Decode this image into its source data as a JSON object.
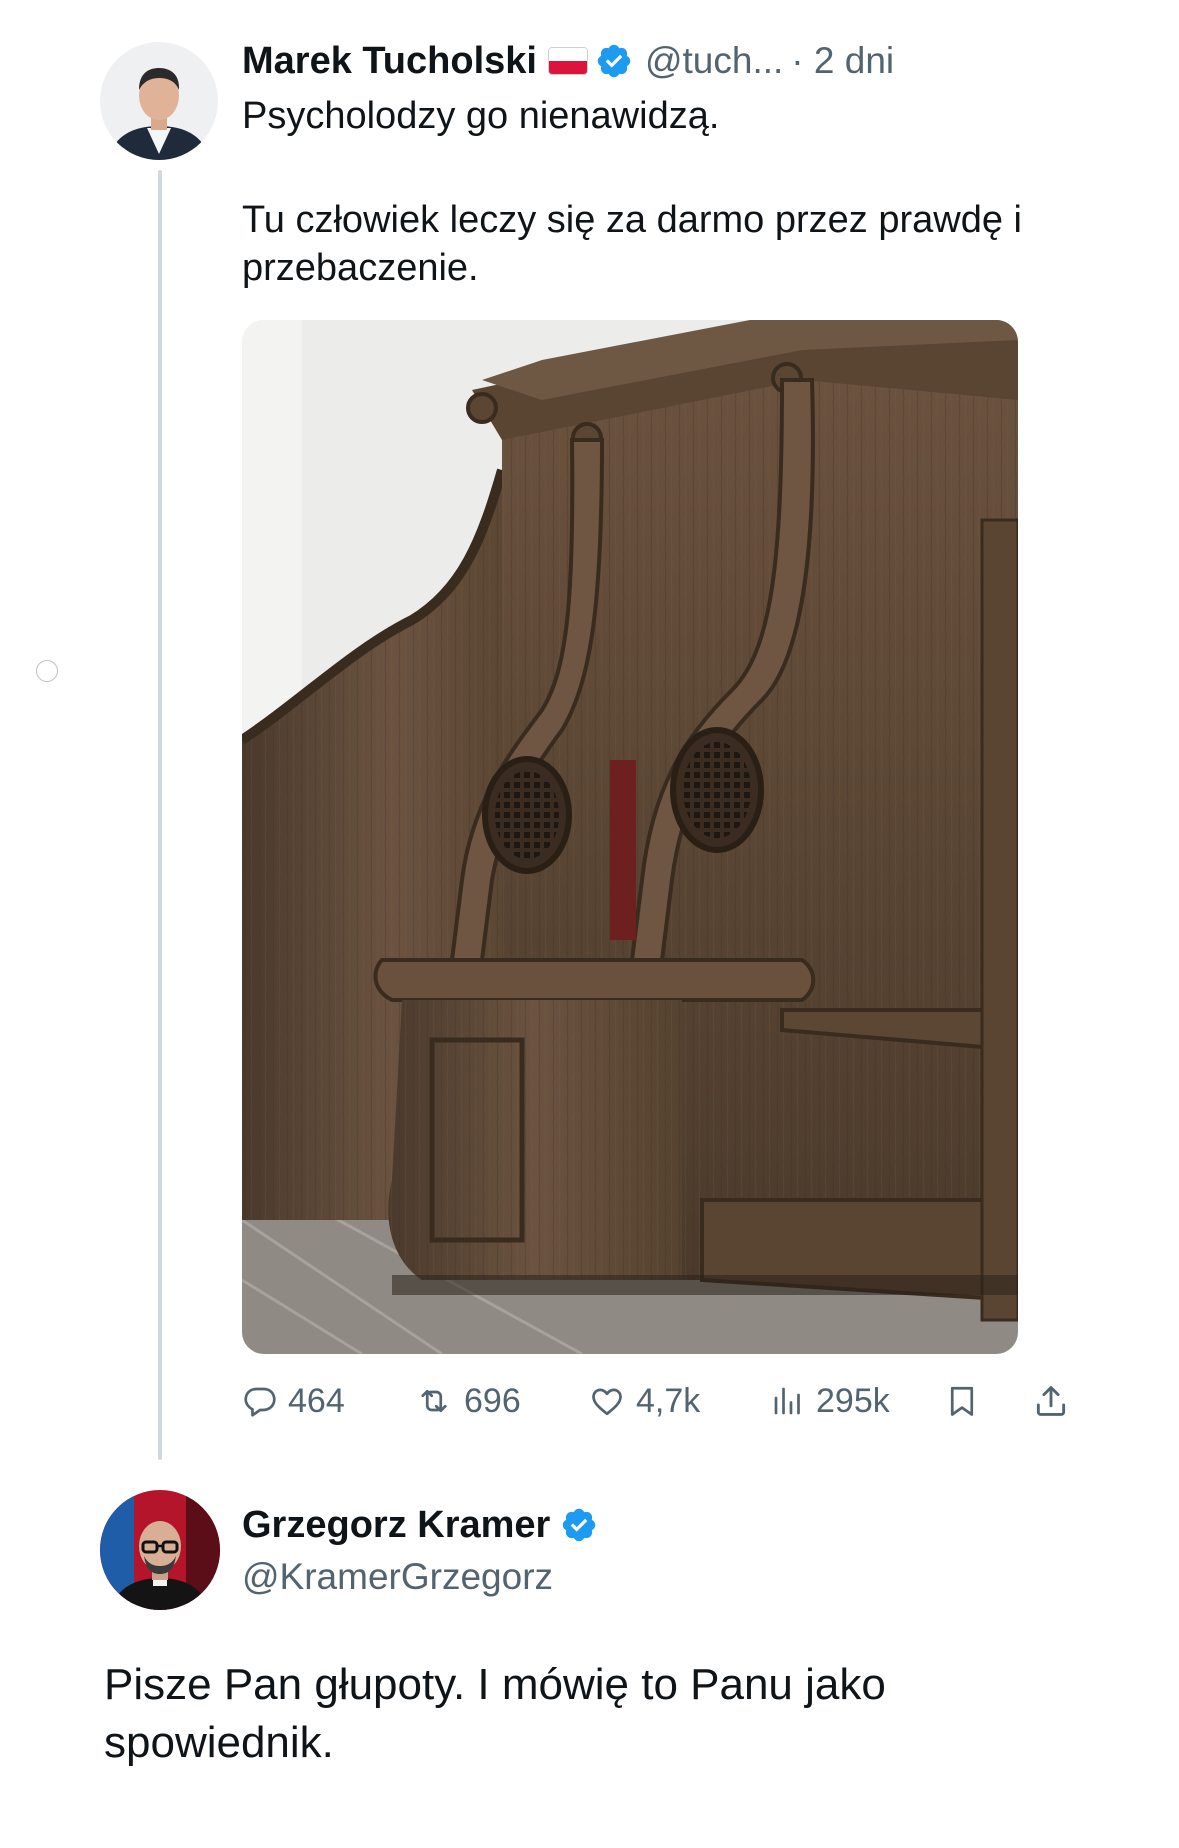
{
  "tweet": {
    "author": {
      "name": "Marek Tucholski",
      "handle": "@tuch...",
      "time": "· 2 dni",
      "flag": "Poland flag",
      "verified_icon": "verified-badge-icon"
    },
    "text_line1": "Psycholodzy go nienawidzą.",
    "text_body": "Tu człowiek leczy się za darmo przez prawdę i\nprzebaczenie.",
    "media_description_icon": "confessional-photo",
    "actions": {
      "replies": "464",
      "reposts": "696",
      "likes": "4,7k",
      "views": "295k"
    }
  },
  "reply": {
    "author": {
      "name": "Grzegorz Kramer",
      "handle": "@KramerGrzegorz",
      "verified_icon": "verified-badge-icon"
    },
    "text": "Pisze Pan głupoty. I mówię to Panu jako\nspowiednik."
  },
  "colors": {
    "text": "#0f1419",
    "secondary": "#536471",
    "verified": "#1d9bf0",
    "thread_line": "#cfd9de"
  }
}
